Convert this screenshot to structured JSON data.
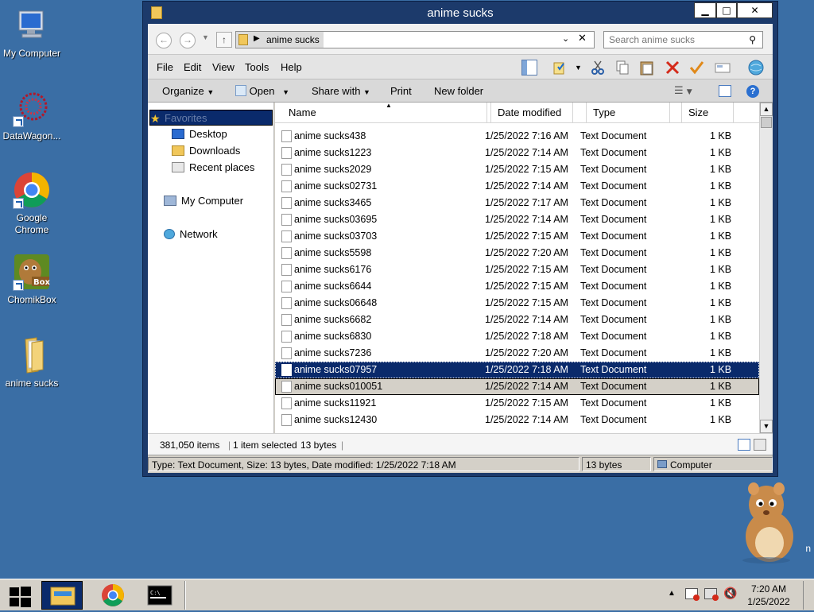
{
  "desktop": {
    "icons": [
      {
        "label": "My Computer",
        "icon": "my-computer-icon"
      },
      {
        "label": "DataWagon...",
        "icon": "datawagon-icon"
      },
      {
        "label": "Google Chrome",
        "icon": "chrome-icon"
      },
      {
        "label": "ChomikBox",
        "icon": "chomikbox-icon"
      },
      {
        "label": "anime sucks",
        "icon": "folder-icon"
      }
    ],
    "hamster_suffix": "n"
  },
  "window": {
    "title": "anime sucks",
    "buttons": {
      "minimize": "▁",
      "maximize": "□",
      "close": "✕"
    },
    "address": {
      "path": "anime sucks"
    },
    "search": {
      "placeholder": "Search anime sucks"
    },
    "menu": [
      "File",
      "Edit",
      "View",
      "Tools",
      "Help"
    ],
    "commands": {
      "organize": "Organize",
      "open": "Open",
      "share_with": "Share with",
      "print": "Print",
      "new_folder": "New folder"
    },
    "nav": {
      "favorites": "Favorites",
      "desktop": "Desktop",
      "downloads": "Downloads",
      "recent_places": "Recent places",
      "my_computer": "My Computer",
      "network": "Network"
    },
    "columns": {
      "name": "Name",
      "date": "Date modified",
      "type": "Type",
      "size": "Size"
    },
    "files": [
      {
        "name": "anime sucks438",
        "date": "1/25/2022 7:16 AM",
        "type": "Text Document",
        "size": "1 KB"
      },
      {
        "name": "anime sucks1223",
        "date": "1/25/2022 7:14 AM",
        "type": "Text Document",
        "size": "1 KB"
      },
      {
        "name": "anime sucks2029",
        "date": "1/25/2022 7:15 AM",
        "type": "Text Document",
        "size": "1 KB"
      },
      {
        "name": "anime sucks02731",
        "date": "1/25/2022 7:14 AM",
        "type": "Text Document",
        "size": "1 KB"
      },
      {
        "name": "anime sucks3465",
        "date": "1/25/2022 7:17 AM",
        "type": "Text Document",
        "size": "1 KB"
      },
      {
        "name": "anime sucks03695",
        "date": "1/25/2022 7:14 AM",
        "type": "Text Document",
        "size": "1 KB"
      },
      {
        "name": "anime sucks03703",
        "date": "1/25/2022 7:15 AM",
        "type": "Text Document",
        "size": "1 KB"
      },
      {
        "name": "anime sucks5598",
        "date": "1/25/2022 7:20 AM",
        "type": "Text Document",
        "size": "1 KB"
      },
      {
        "name": "anime sucks6176",
        "date": "1/25/2022 7:15 AM",
        "type": "Text Document",
        "size": "1 KB"
      },
      {
        "name": "anime sucks6644",
        "date": "1/25/2022 7:15 AM",
        "type": "Text Document",
        "size": "1 KB"
      },
      {
        "name": "anime sucks06648",
        "date": "1/25/2022 7:15 AM",
        "type": "Text Document",
        "size": "1 KB"
      },
      {
        "name": "anime sucks6682",
        "date": "1/25/2022 7:14 AM",
        "type": "Text Document",
        "size": "1 KB"
      },
      {
        "name": "anime sucks6830",
        "date": "1/25/2022 7:18 AM",
        "type": "Text Document",
        "size": "1 KB"
      },
      {
        "name": "anime sucks7236",
        "date": "1/25/2022 7:20 AM",
        "type": "Text Document",
        "size": "1 KB"
      },
      {
        "name": "anime sucks07957",
        "date": "1/25/2022 7:18 AM",
        "type": "Text Document",
        "size": "1 KB"
      },
      {
        "name": "anime sucks010051",
        "date": "1/25/2022 7:14 AM",
        "type": "Text Document",
        "size": "1 KB"
      },
      {
        "name": "anime sucks11921",
        "date": "1/25/2022 7:15 AM",
        "type": "Text Document",
        "size": "1 KB"
      },
      {
        "name": "anime sucks12430",
        "date": "1/25/2022 7:14 AM",
        "type": "Text Document",
        "size": "1 KB"
      }
    ],
    "selected_index": 14,
    "focused_index": 15,
    "count": {
      "items": "381,050 items",
      "selected": "1 item selected",
      "bytes": "13 bytes"
    },
    "status": {
      "info": "Type: Text Document, Size: 13 bytes, Date modified: 1/25/2022 7:18 AM",
      "size": "13 bytes",
      "zone": "Computer"
    }
  },
  "taskbar": {
    "clock": {
      "time": "7:20 AM",
      "date": "1/25/2022"
    }
  },
  "colors": {
    "desktop_bg": "#3a6ea5",
    "window_frame": "#1c3a6b",
    "selection": "#0a2a6b"
  }
}
